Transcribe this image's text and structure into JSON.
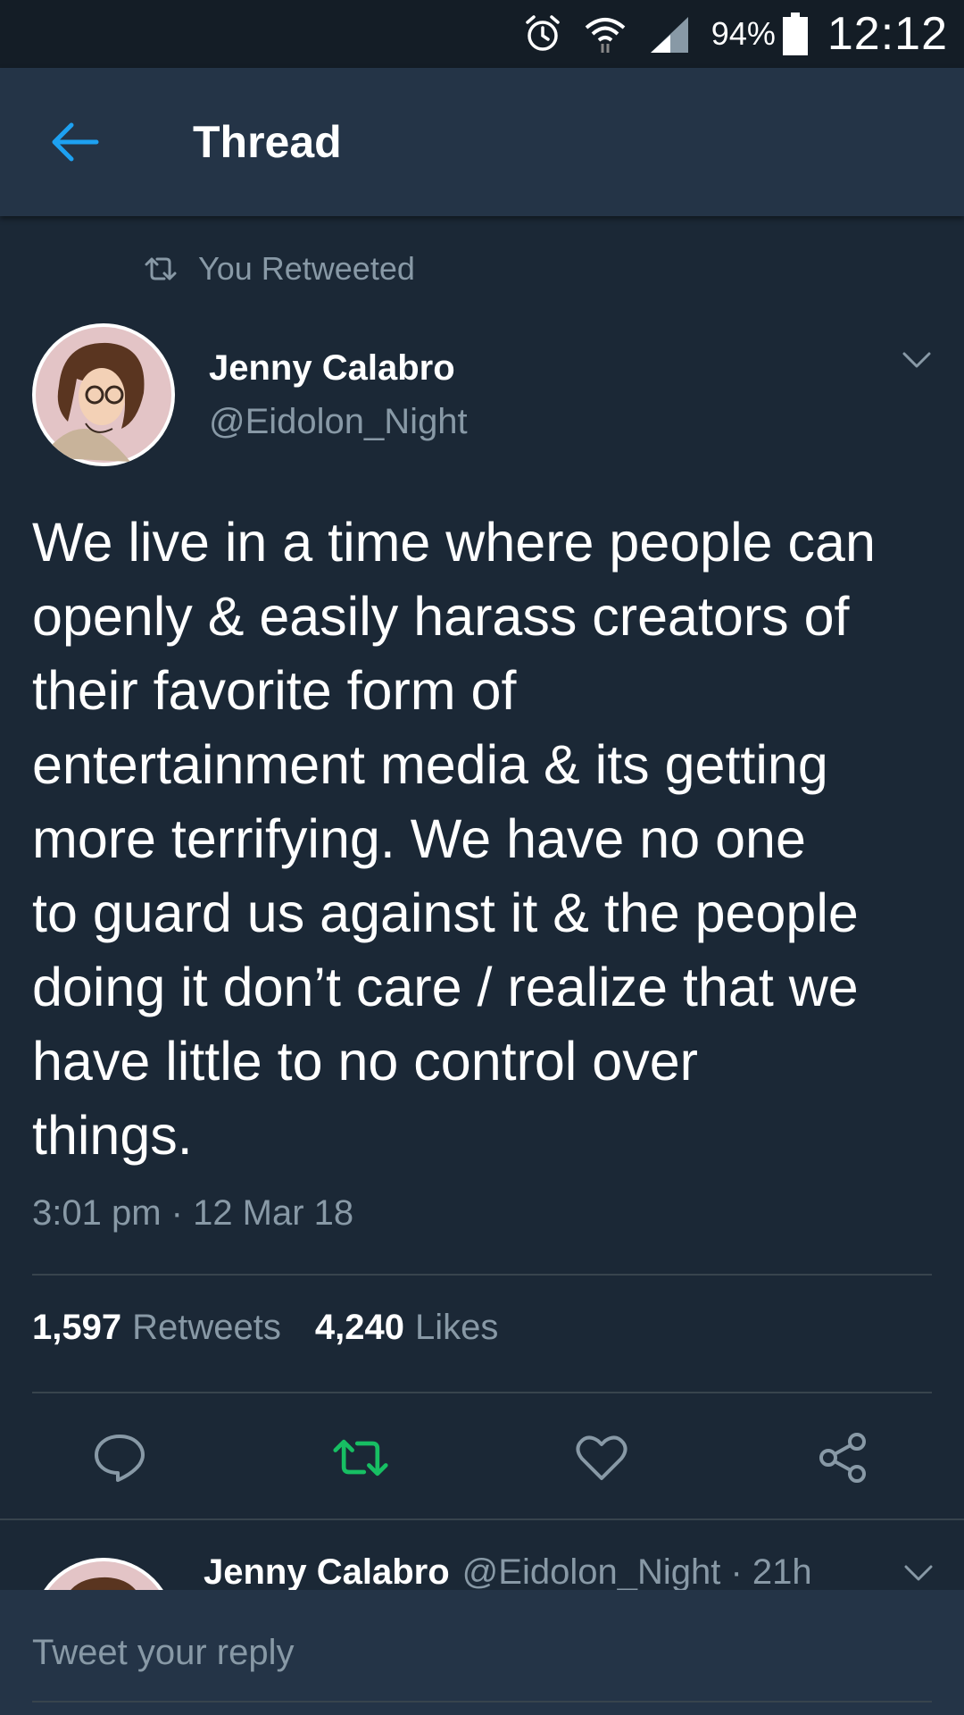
{
  "status_bar": {
    "battery": "94%",
    "time": "12:12",
    "icons": [
      "alarm-icon",
      "wifi-icon",
      "signal-icon",
      "battery-icon"
    ]
  },
  "header": {
    "title": "Thread",
    "back_icon": "back-arrow-icon"
  },
  "tweet": {
    "retweet_context": "You Retweeted",
    "author_name": "Jenny Calabro",
    "author_handle": "@Eidolon_Night",
    "text": "We live in a time where people can\nopenly & easily harass creators of\ntheir favorite form of\nentertainment media & its getting\nmore terrifying.  We have no one\nto guard us against it & the people\ndoing it don’t care / realize that we\nhave little to no control over\nthings.",
    "timestamp": "3:01 pm · 12 Mar 18",
    "retweets_count": "1,597",
    "retweets_label": "Retweets",
    "likes_count": "4,240",
    "likes_label": "Likes",
    "retweeted_by_me": true
  },
  "reply_preview": {
    "author_name": "Jenny Calabro",
    "meta": "@Eidolon_Night · 21h"
  },
  "compose": {
    "placeholder": "Tweet your reply"
  },
  "colors": {
    "background": "#1b2836",
    "header": "#243447",
    "secondary_text": "#8899a6",
    "accent_blue": "#1da1f2",
    "retweet_green": "#17bf63"
  }
}
